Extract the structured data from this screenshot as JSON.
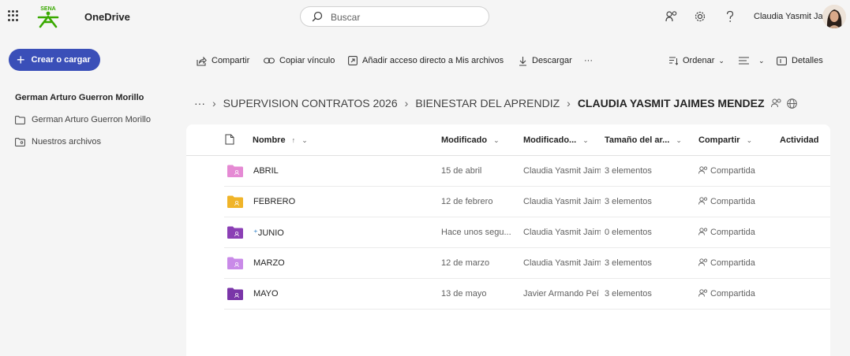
{
  "header": {
    "app_name": "OneDrive",
    "logo_text": "SENA",
    "search_placeholder": "Buscar",
    "user_name": "Claudia Yasmit Jai..."
  },
  "nav": {
    "create_label": "Crear o cargar",
    "heading": "German Arturo Guerron Morillo",
    "items": [
      {
        "label": "German Arturo Guerron Morillo",
        "icon": "folder-icon"
      },
      {
        "label": "Nuestros archivos",
        "icon": "shared-files-icon"
      }
    ]
  },
  "commands": {
    "share": "Compartir",
    "copy_link": "Copiar vínculo",
    "add_shortcut": "Añadir acceso directo a Mis archivos",
    "download": "Descargar",
    "more": "···",
    "sort": "Ordenar",
    "details": "Detalles"
  },
  "breadcrumb": {
    "ellipsis": "···",
    "items": [
      "SUPERVISION CONTRATOS 2026",
      "BIENESTAR DEL APRENDIZ"
    ],
    "current": "CLAUDIA YASMIT JAIMES MENDEZ"
  },
  "columns": {
    "name": "Nombre",
    "name_sort": "↑",
    "modified": "Modificado",
    "modified_by": "Modificado...",
    "size": "Tamaño del ar...",
    "sharing": "Compartir",
    "activity": "Actividad"
  },
  "rows": [
    {
      "name": "ABRIL",
      "modified": "15 de abril",
      "modified_by": "Claudia Yasmit Jaim",
      "size": "3 elementos",
      "sharing": "Compartida",
      "folder_color": "#e58ad3",
      "prefix": ""
    },
    {
      "name": "FEBRERO",
      "modified": "12 de febrero",
      "modified_by": "Claudia Yasmit Jaim",
      "size": "3 elementos",
      "sharing": "Compartida",
      "folder_color": "#f0b429",
      "prefix": ""
    },
    {
      "name": "JUNIO",
      "modified": "Hace unos segu...",
      "modified_by": "Claudia Yasmit Jaim",
      "size": "0 elementos",
      "sharing": "Compartida",
      "folder_color": "#8b3fb5",
      "prefix": "⁺"
    },
    {
      "name": "MARZO",
      "modified": "12 de marzo",
      "modified_by": "Claudia Yasmit Jaim",
      "size": "3 elementos",
      "sharing": "Compartida",
      "folder_color": "#c98ae8",
      "prefix": ""
    },
    {
      "name": "MAYO",
      "modified": "13 de mayo",
      "modified_by": "Javier Armando Peí",
      "size": "3 elementos",
      "sharing": "Compartida",
      "folder_color": "#7a35a8",
      "prefix": ""
    }
  ],
  "colors": {
    "accent": "#3a4fb8",
    "logo_green": "#39a900"
  }
}
